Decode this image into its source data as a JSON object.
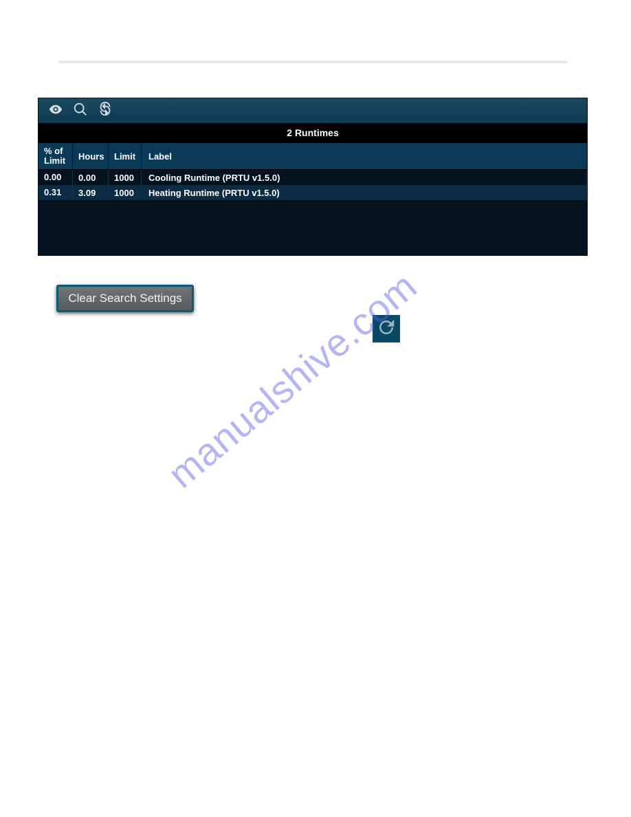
{
  "watermark": "manualshive.com",
  "panel": {
    "title": "2 Runtimes",
    "headers": {
      "pct": "% of Limit",
      "hours": "Hours",
      "limit": "Limit",
      "label": "Label"
    },
    "rows": [
      {
        "pct": "0.00",
        "hours": "0.00",
        "limit": "1000",
        "label": "Cooling Runtime (PRTU v1.5.0)"
      },
      {
        "pct": "0.31",
        "hours": "3.09",
        "limit": "1000",
        "label": "Heating Runtime (PRTU v1.5.0)"
      }
    ]
  },
  "buttons": {
    "clear": "Clear Search Settings"
  }
}
